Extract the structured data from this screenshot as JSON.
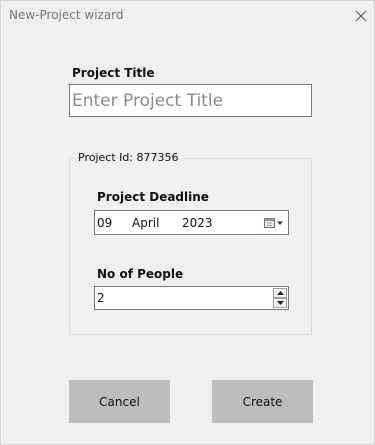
{
  "window": {
    "title": "New-Project wizard",
    "close_icon": "close-icon"
  },
  "project_title": {
    "label": "Project Title",
    "placeholder": "Enter Project Title",
    "value": ""
  },
  "project_group": {
    "legend": "Project Id: 877356",
    "deadline": {
      "label": "Project Deadline",
      "day": "09",
      "month": "April",
      "year": "2023",
      "dropdown_icon": "calendar-dropdown-icon"
    },
    "people": {
      "label": "No of People",
      "value": "2",
      "up_icon": "spin-up-icon",
      "down_icon": "spin-down-icon"
    }
  },
  "buttons": {
    "cancel": "Cancel",
    "create": "Create"
  },
  "colors": {
    "window_bg": "#f0f0f0",
    "button_bg": "#bdbdbd",
    "input_border": "#7a7a7a",
    "group_border": "#dcdcdc"
  }
}
